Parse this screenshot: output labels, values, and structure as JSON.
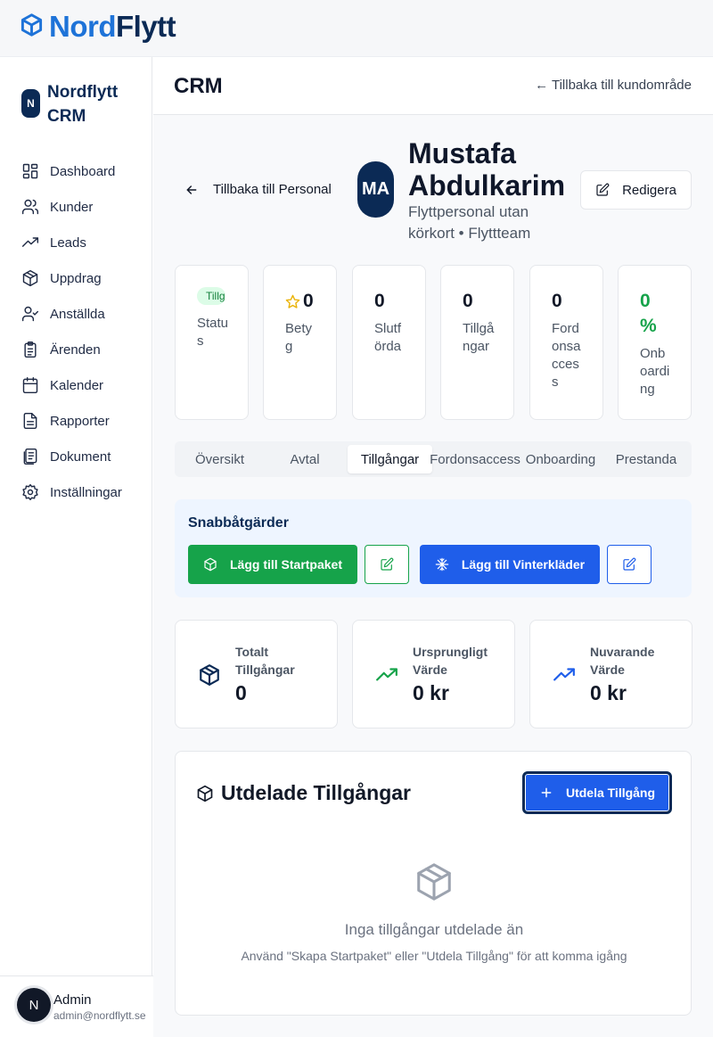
{
  "logo": {
    "part1": "Nord",
    "part2": "Flytt"
  },
  "sidebar": {
    "brand_badge": "N",
    "brand_title": "Nordflytt CRM",
    "items": [
      {
        "label": "Dashboard",
        "icon": "dashboard-icon"
      },
      {
        "label": "Kunder",
        "icon": "users-icon"
      },
      {
        "label": "Leads",
        "icon": "trending-up-icon"
      },
      {
        "label": "Uppdrag",
        "icon": "package-icon"
      },
      {
        "label": "Anställda",
        "icon": "user-check-icon"
      },
      {
        "label": "Ärenden",
        "icon": "clipboard-icon"
      },
      {
        "label": "Kalender",
        "icon": "calendar-icon"
      },
      {
        "label": "Rapporter",
        "icon": "file-text-icon"
      },
      {
        "label": "Dokument",
        "icon": "documents-icon"
      },
      {
        "label": "Inställningar",
        "icon": "settings-icon"
      }
    ],
    "user": {
      "initial": "N",
      "name": "Admin",
      "email": "admin@nordflytt.se"
    }
  },
  "header": {
    "title": "CRM",
    "back_link": "← Tillbaka till kundområde"
  },
  "profile": {
    "back_label": "Tillbaka till Personal",
    "initials": "MA",
    "name": "Mustafa Abdulkarim",
    "role": "Flyttpersonal utan körkort • Flyttteam",
    "edit_label": "Redigera"
  },
  "stats": {
    "status": {
      "badge": "Tillgänglig",
      "label": "Status"
    },
    "rating": {
      "value": "0",
      "label": "Betyg"
    },
    "completed": {
      "value": "0",
      "label": "Slutförda"
    },
    "assets": {
      "value": "0",
      "label": "Tillgångar"
    },
    "vehicle": {
      "value": "0",
      "label": "Fordonsaccess"
    },
    "onboarding": {
      "value": "0 %",
      "label": "Onboarding"
    }
  },
  "tabs": [
    "Översikt",
    "Avtal",
    "Tillgångar",
    "Fordonsaccess",
    "Onboarding",
    "Prestanda"
  ],
  "active_tab": "Tillgångar",
  "quick_actions": {
    "title": "Snabbåtgärder",
    "start_pack": "Lägg till Startpaket",
    "winter": "Lägg till Vinterkläder"
  },
  "summary": {
    "total": {
      "label": "Totalt Tillgångar",
      "value": "0"
    },
    "original": {
      "label": "Ursprungligt Värde",
      "value": "0 kr"
    },
    "current": {
      "label": "Nuvarande Värde",
      "value": "0 kr"
    }
  },
  "assets_panel": {
    "title": "Utdelade Tillgångar",
    "button": "Utdela Tillgång",
    "empty_title": "Inga tillgångar utdelade än",
    "empty_sub": "Använd \"Skapa Startpaket\" eller \"Utdela Tillgång\" för att komma igång"
  },
  "colors": {
    "brand_dark": "#0b2a55",
    "brand_blue": "#1e73d8",
    "green_button": "#16a34a",
    "blue_button": "#1f5eea",
    "success_text": "#16a34a"
  }
}
